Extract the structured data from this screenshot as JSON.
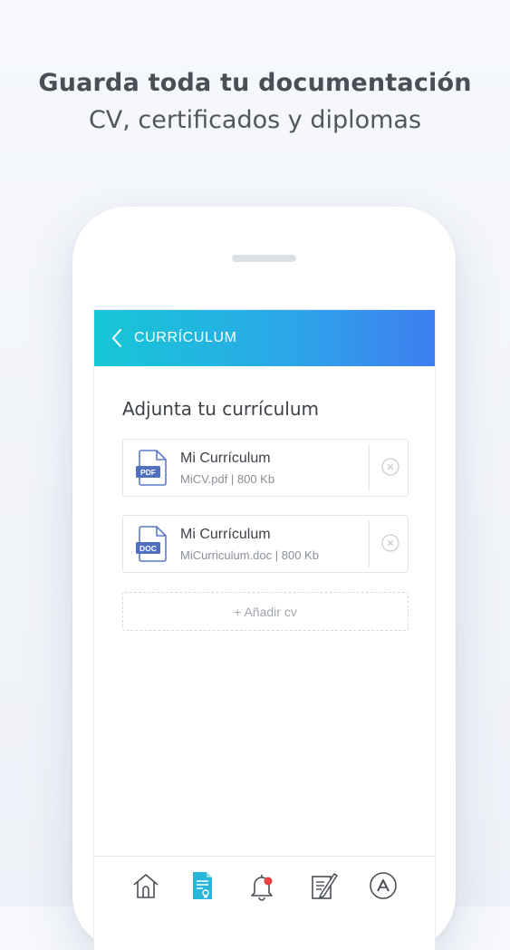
{
  "headline": {
    "title": "Guarda toda tu documentación",
    "subtitle": "CV, certificados y diplomas"
  },
  "appbar": {
    "title": "CURRÍCULUM",
    "gradient": [
      "#17c7d6",
      "#3e7ef0"
    ]
  },
  "section": {
    "title": "Adjunta tu currículum"
  },
  "files": [
    {
      "name": "Mi Currículum",
      "meta": "MiCV.pdf | 800 Kb",
      "badge": "PDF",
      "icon": "pdf-file-icon"
    },
    {
      "name": "Mi Currículum",
      "meta": "MiCurriculum.doc | 800 Kb",
      "badge": "DOC",
      "icon": "doc-file-icon"
    }
  ],
  "add_button": {
    "label": "+ Añadir cv"
  },
  "nav": {
    "items": [
      {
        "icon": "home-icon",
        "active": false
      },
      {
        "icon": "document-icon",
        "active": true
      },
      {
        "icon": "bell-icon",
        "active": false,
        "badge_color": "#e8403f"
      },
      {
        "icon": "edit-note-icon",
        "active": false
      },
      {
        "icon": "profile-logo-icon",
        "active": false
      }
    ],
    "active_color": "#2ab6d9",
    "inactive_color": "#4a4f57"
  }
}
